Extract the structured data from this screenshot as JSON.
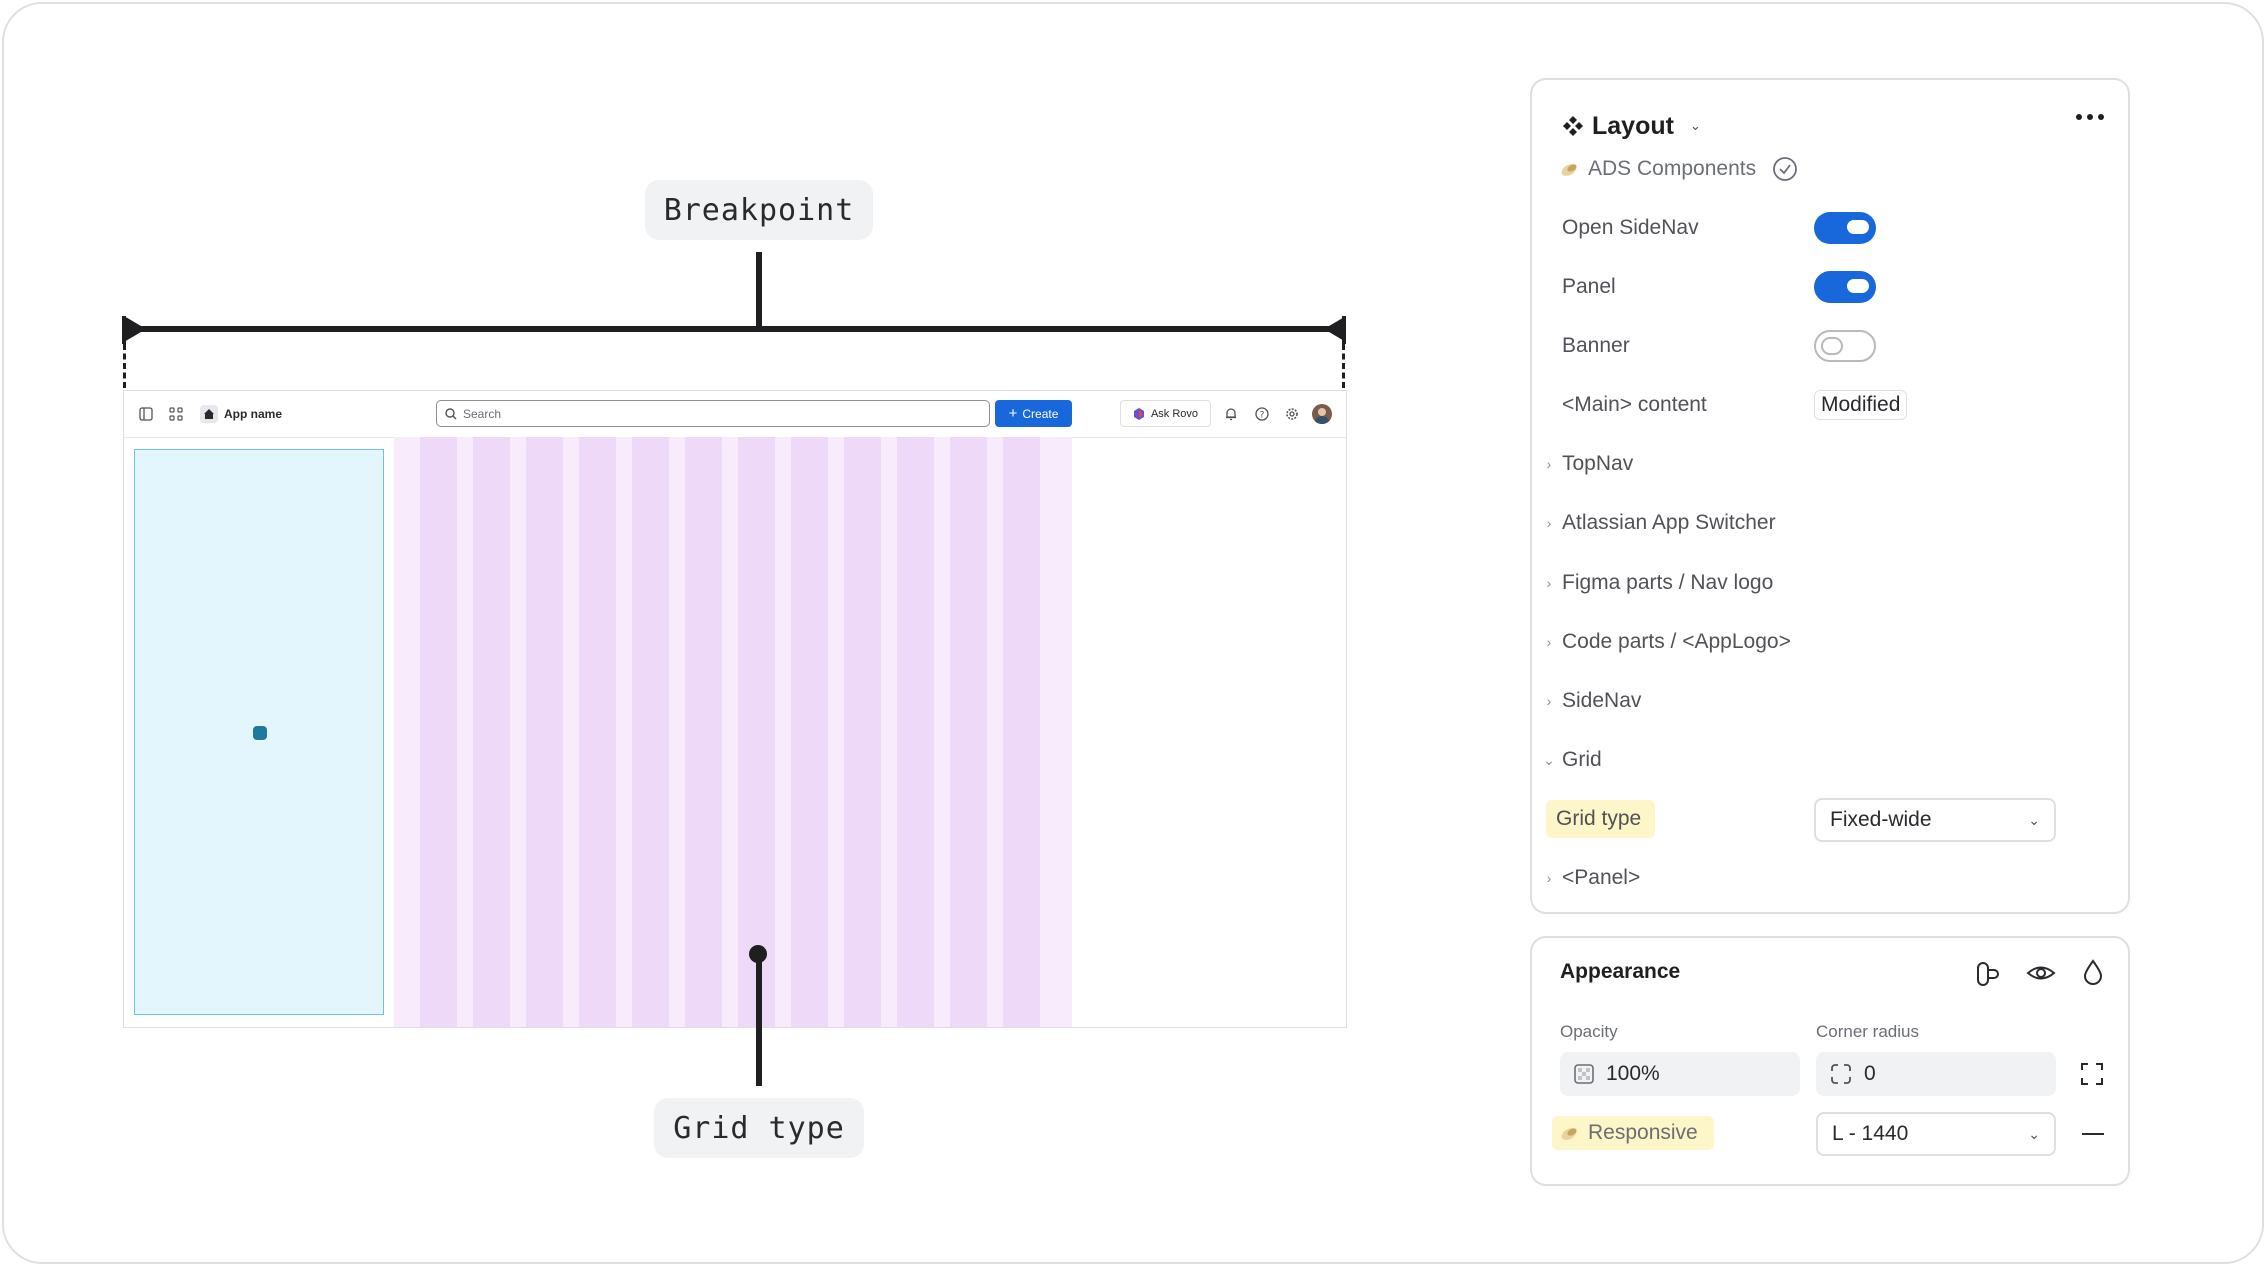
{
  "annotations": {
    "breakpoint_label": "Breakpoint",
    "grid_type_label": "Grid type"
  },
  "mock_app": {
    "app_name": "App name",
    "search_placeholder": "Search",
    "create_label": "Create",
    "ask_rovo_label": "Ask Rovo",
    "grid_columns": 12
  },
  "layout_panel": {
    "title": "Layout",
    "library": "ADS Components",
    "properties": [
      {
        "label": "Open SideNav",
        "type": "toggle",
        "value": true
      },
      {
        "label": "Panel",
        "type": "toggle",
        "value": true
      },
      {
        "label": "Banner",
        "type": "toggle",
        "value": false
      },
      {
        "label": "<Main> content",
        "type": "chip",
        "value": "Modified"
      }
    ],
    "layers": [
      {
        "label": "TopNav",
        "expanded": false
      },
      {
        "label": "Atlassian App Switcher",
        "expanded": false
      },
      {
        "label": "Figma parts / Nav logo",
        "expanded": false
      },
      {
        "label": "Code parts / <AppLogo>",
        "expanded": false
      },
      {
        "label": "SideNav",
        "expanded": false
      },
      {
        "label": "Grid",
        "expanded": true
      }
    ],
    "grid_type": {
      "label": "Grid type",
      "value": "Fixed-wide"
    },
    "panel_layer": {
      "label": "<Panel>",
      "expanded": false
    }
  },
  "appearance_panel": {
    "title": "Appearance",
    "opacity_label": "Opacity",
    "opacity_value": "100%",
    "corner_radius_label": "Corner radius",
    "corner_radius_value": "0",
    "responsive_label": "Responsive",
    "responsive_value": "L - 1440"
  },
  "colors": {
    "accent": "#1868db",
    "sidenav_fill": "#e3f6fd",
    "grid_fill": "#f8ecfc",
    "grid_column": "#efd9f8",
    "highlight": "#fdf6c8"
  }
}
